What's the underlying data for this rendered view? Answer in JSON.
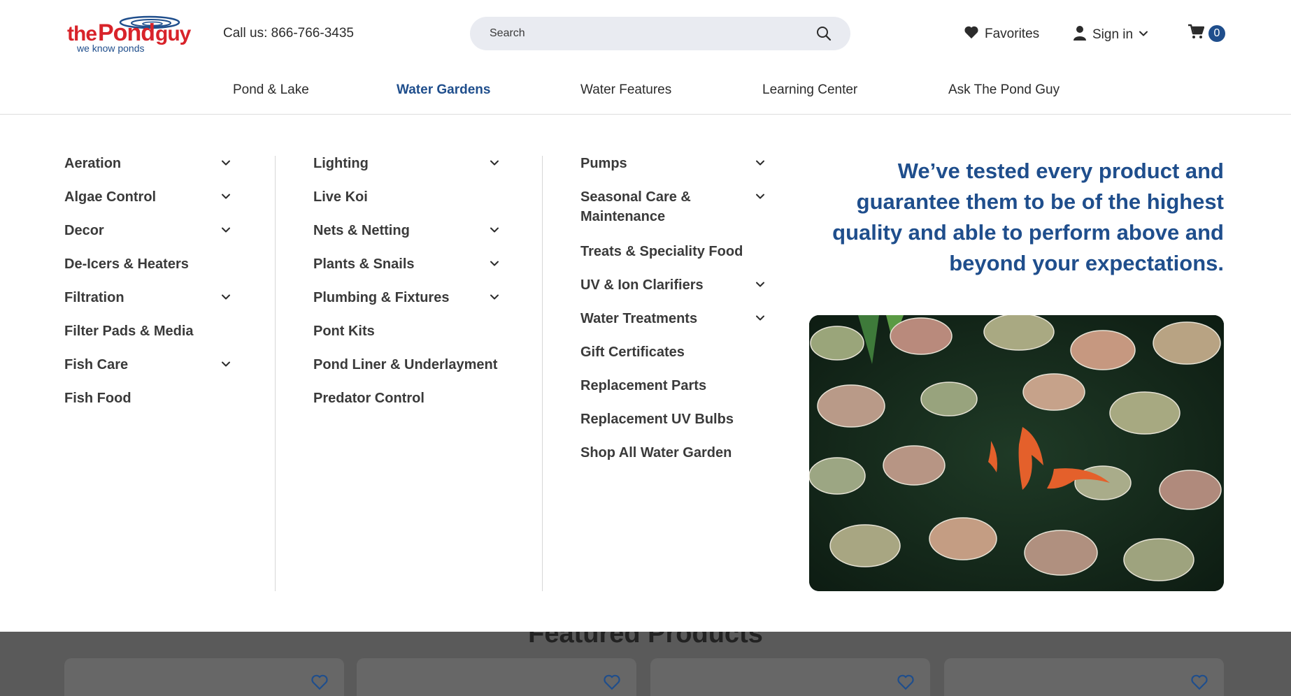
{
  "header": {
    "logo": {
      "brand": "thePondguy",
      "tagline": "we know ponds"
    },
    "phone": "Call us: 866-766-3435",
    "search": {
      "placeholder": "Search",
      "value": ""
    },
    "favorites_label": "Favorites",
    "signin_label": "Sign in",
    "cart_count": "0"
  },
  "nav": {
    "items": [
      {
        "label": "Pond & Lake"
      },
      {
        "label": "Water Gardens"
      },
      {
        "label": "Water Features"
      },
      {
        "label": "Learning Center"
      },
      {
        "label": "Ask The Pond Guy"
      }
    ],
    "active": "Water Gardens"
  },
  "menu": {
    "col1": [
      {
        "label": "Aeration",
        "expandable": true
      },
      {
        "label": "Algae Control",
        "expandable": true
      },
      {
        "label": "Decor",
        "expandable": true
      },
      {
        "label": "De-Icers & Heaters",
        "expandable": false
      },
      {
        "label": "Filtration",
        "expandable": true
      },
      {
        "label": "Filter Pads & Media",
        "expandable": false
      },
      {
        "label": "Fish Care",
        "expandable": true
      },
      {
        "label": "Fish Food",
        "expandable": false
      }
    ],
    "col2": [
      {
        "label": "Lighting",
        "expandable": true
      },
      {
        "label": "Live Koi",
        "expandable": false
      },
      {
        "label": "Nets & Netting",
        "expandable": true
      },
      {
        "label": "Plants & Snails",
        "expandable": true
      },
      {
        "label": "Plumbing & Fixtures",
        "expandable": true
      },
      {
        "label": "Pont Kits",
        "expandable": false
      },
      {
        "label": "Pond Liner & Underlayment",
        "expandable": false
      },
      {
        "label": "Predator Control",
        "expandable": false
      }
    ],
    "col3": [
      {
        "label": "Pumps",
        "expandable": true
      },
      {
        "label": "Seasonal Care & Maintenance",
        "expandable": true
      },
      {
        "label": "Treats & Speciality Food",
        "expandable": false
      },
      {
        "label": "UV & Ion Clarifiers",
        "expandable": true
      },
      {
        "label": "Water Treatments",
        "expandable": true
      },
      {
        "label": "Gift Certificates",
        "expandable": false
      },
      {
        "label": "Replacement Parts",
        "expandable": false
      },
      {
        "label": "Replacement UV Bulbs",
        "expandable": false
      },
      {
        "label": "Shop All Water Garden",
        "expandable": false
      }
    ],
    "tagline": "We’ve tested every product and guarantee them to be of the highest quality and able to perform above and beyond your expectations."
  },
  "below": {
    "section_title": "Featured Products"
  },
  "colors": {
    "brand_blue": "#1f4e8c",
    "brand_red": "#d8232a",
    "text": "#2b2b2b"
  }
}
